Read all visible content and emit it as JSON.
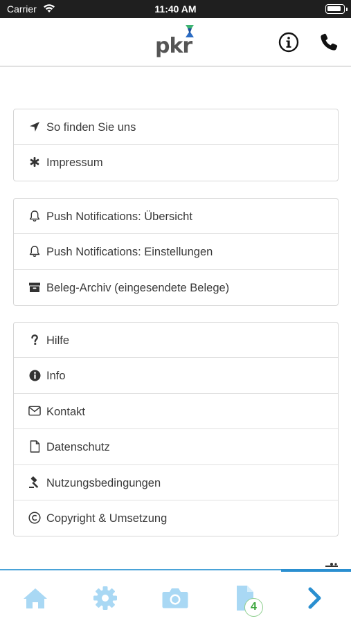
{
  "status_bar": {
    "carrier": "Carrier",
    "time": "11:40 AM"
  },
  "header": {
    "logo_text": "pkr",
    "info_icon": "info-circle-icon",
    "phone_icon": "phone-icon"
  },
  "menu_groups": [
    {
      "items": [
        {
          "label": "So finden Sie uns",
          "icon": "location-arrow-icon"
        },
        {
          "label": "Impressum",
          "icon": "asterisk-icon"
        }
      ]
    },
    {
      "items": [
        {
          "label": "Push Notifications: Übersicht",
          "icon": "bell-icon"
        },
        {
          "label": "Push Notifications: Einstellungen",
          "icon": "bell-icon"
        },
        {
          "label": "Beleg-Archiv (eingesendete Belege)",
          "icon": "archive-icon"
        }
      ]
    },
    {
      "items": [
        {
          "label": "Hilfe",
          "icon": "question-icon"
        },
        {
          "label": "Info",
          "icon": "info-icon"
        },
        {
          "label": "Kontakt",
          "icon": "envelope-icon"
        },
        {
          "label": "Datenschutz",
          "icon": "file-icon"
        },
        {
          "label": "Nutzungsbedingungen",
          "icon": "gavel-icon"
        },
        {
          "label": "Copyright & Umsetzung",
          "icon": "copyright-icon"
        }
      ]
    }
  ],
  "tab_bar": {
    "tabs": [
      {
        "name": "home",
        "icon": "home-icon"
      },
      {
        "name": "settings",
        "icon": "gear-icon"
      },
      {
        "name": "camera",
        "icon": "camera-icon"
      },
      {
        "name": "documents",
        "icon": "document-icon"
      },
      {
        "name": "next",
        "icon": "chevron-right-icon"
      }
    ],
    "documents_badge": "4"
  },
  "colors": {
    "accent": "#2a8fd0",
    "tab_icon_light": "#a9d8f4",
    "badge_green": "#3ca53c",
    "logo_green": "#3cb371",
    "logo_blue": "#2b6cc4"
  }
}
